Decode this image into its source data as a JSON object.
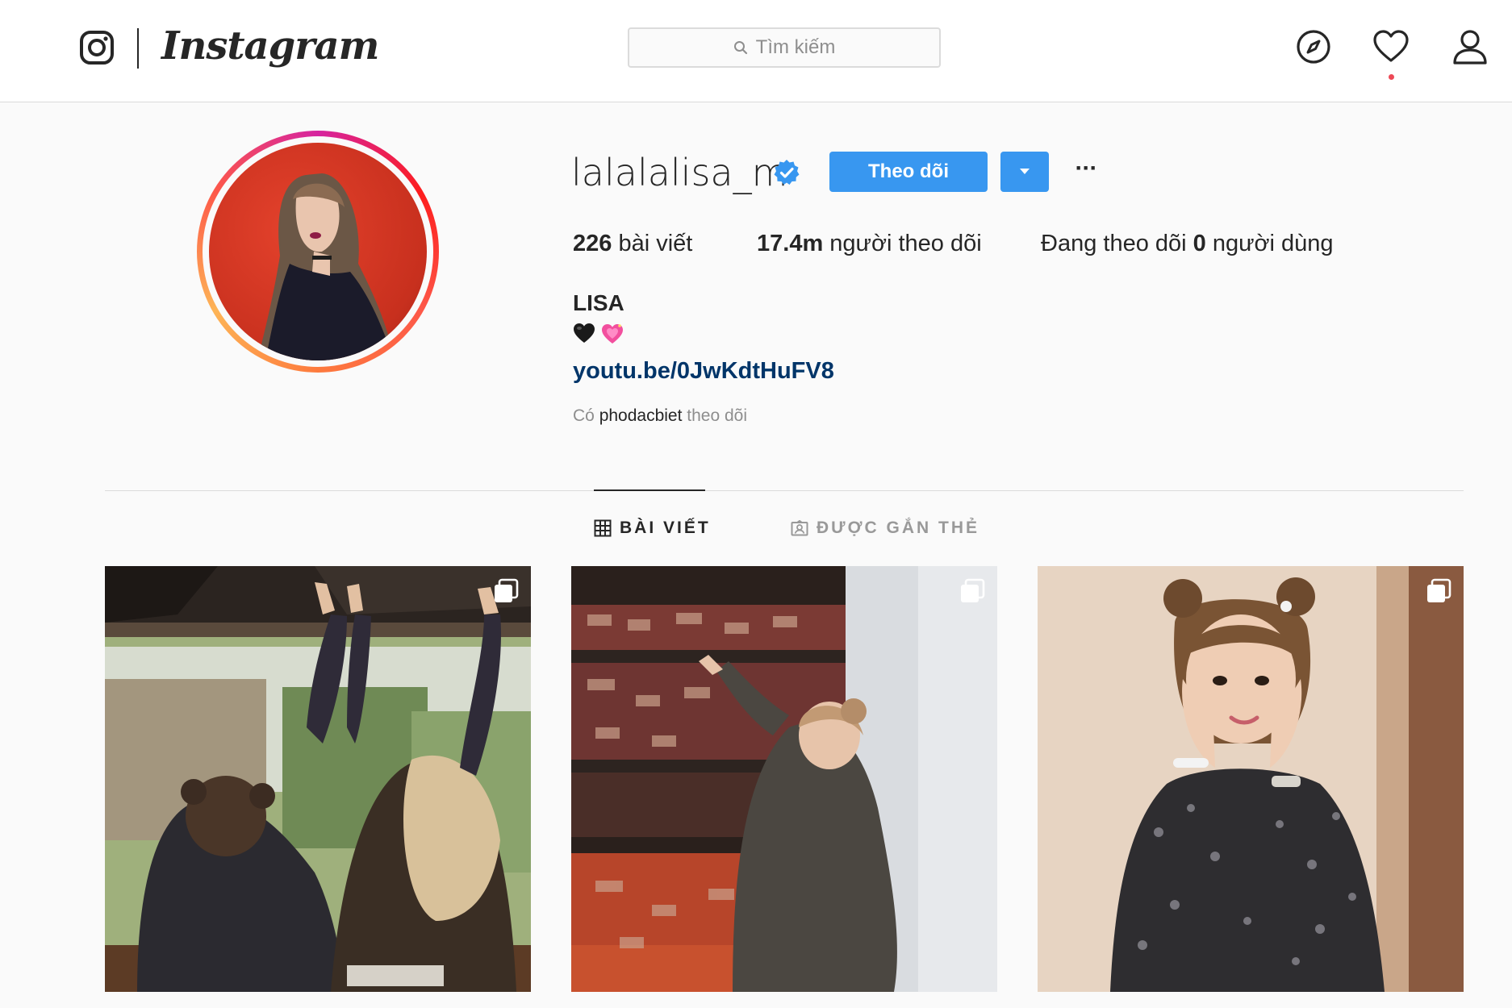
{
  "nav": {
    "brand": "Instagram",
    "search_placeholder": "Tìm kiếm",
    "icons": [
      "instagram-glyph-icon",
      "search-icon",
      "compass-icon",
      "heart-icon",
      "user-icon"
    ],
    "notification_dot_color": "#ed4956"
  },
  "profile": {
    "username": "lalalalisa_m",
    "verified": true,
    "follow_label": "Theo dõi",
    "more_label": "···",
    "stats": {
      "posts_count": "226",
      "posts_label": " bài viết",
      "followers_count": "17.4m",
      "followers_label": " người theo dõi",
      "following_prefix": "Đang theo dõi ",
      "following_count": "0",
      "following_suffix": " người dùng"
    },
    "full_name": "LISA",
    "bio_emojis": [
      "black-heart",
      "sparkling-heart"
    ],
    "link": "youtu.be/0JwKdtHuFV8",
    "followed_by_prefix": "Có ",
    "followed_by_name": "phodacbiet",
    "followed_by_suffix": " theo dõi"
  },
  "tabs": [
    {
      "label": "BÀI VIẾT",
      "icon": "grid-icon",
      "active": true
    },
    {
      "label": "ĐƯỢC GẮN THẺ",
      "icon": "tagged-icon",
      "active": false
    }
  ],
  "posts": [
    {
      "icon": "multiple-photos-icon"
    },
    {
      "icon": "multiple-photos-icon"
    },
    {
      "icon": "multiple-photos-icon"
    }
  ],
  "colors": {
    "accent": "#3897f0",
    "link": "#003569",
    "muted": "#8e8e8e",
    "border": "#dbdbdb",
    "background": "#fafafa"
  }
}
